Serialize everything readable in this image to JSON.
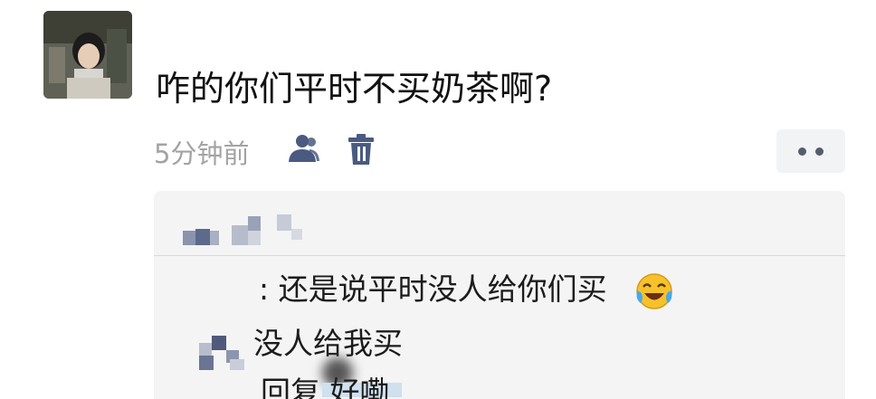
{
  "post": {
    "text": "咋的你们平时不买奶茶啊?",
    "time": "5分钟前"
  },
  "icons": {
    "avatar": "user-avatar-photo",
    "people": "people-icon",
    "trash": "trash-icon",
    "more": "more-dots-icon",
    "emoji": "crying-laughing-emoji"
  },
  "comments": [
    {
      "text": ": 还是说平时没人给你们买"
    },
    {
      "text": "没人给我买"
    },
    {
      "text": "回复 好嘞"
    }
  ],
  "colors": {
    "accent_icon": "#4a5a80",
    "time_gray": "#a3a3a3",
    "panel_bg": "#f4f4f5"
  }
}
